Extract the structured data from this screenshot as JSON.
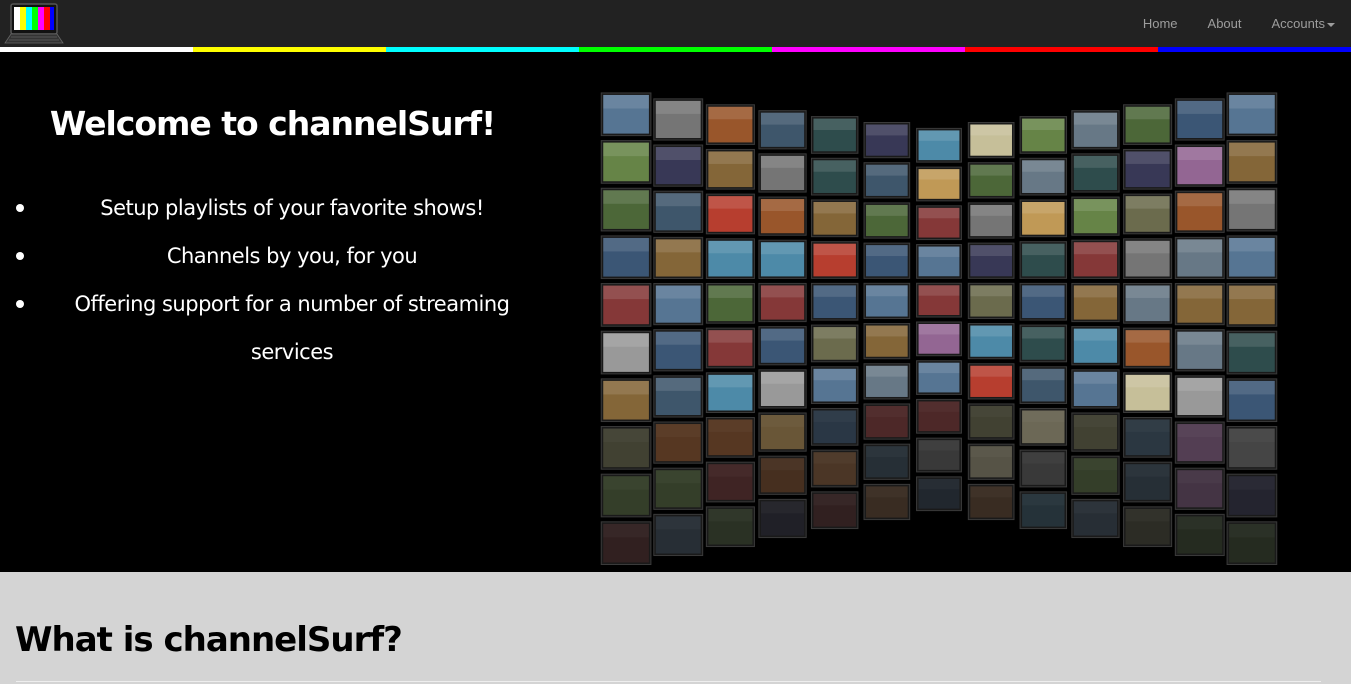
{
  "navbar": {
    "logo_icon": "tv-color-bars-icon",
    "links": {
      "home": "Home",
      "about": "About",
      "accounts": "Accounts"
    },
    "stripe_colors": [
      "#ffffff",
      "#ffff00",
      "#00ffff",
      "#00ff00",
      "#ff00ff",
      "#ff0000",
      "#0000ff"
    ]
  },
  "hero": {
    "title": "Welcome to channelSurf!",
    "features": [
      "Setup playlists of your favorite shows!",
      "Channels by you, for you",
      "Offering support for a number of streaming services"
    ],
    "image_icon": "tv-wall-image"
  },
  "info": {
    "heading": "What is channelSurf?"
  },
  "colors": {
    "navbar_bg": "#222222",
    "nav_text": "#9d9d9d",
    "hero_bg": "#000000",
    "info_bg": "#d4d4d4"
  }
}
